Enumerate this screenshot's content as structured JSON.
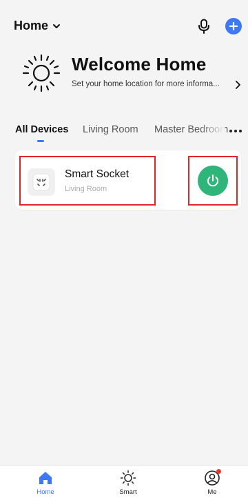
{
  "header": {
    "home_label": "Home"
  },
  "welcome": {
    "title": "Welcome Home",
    "subtitle": "Set your home location for more informa..."
  },
  "tabs": [
    {
      "label": "All Devices",
      "active": true
    },
    {
      "label": "Living Room",
      "active": false
    },
    {
      "label": "Master Bedroom",
      "active": false
    }
  ],
  "device": {
    "name": "Smart Socket",
    "room": "Living Room",
    "power_color": "#2fb57a"
  },
  "bottom_nav": [
    {
      "label": "Home",
      "icon": "home-icon",
      "active": true
    },
    {
      "label": "Smart",
      "icon": "sun-icon",
      "active": false
    },
    {
      "label": "Me",
      "icon": "profile-icon",
      "active": false
    }
  ],
  "colors": {
    "accent": "#3e78f7",
    "highlight": "#e0242b",
    "notification": "#ea3b33"
  }
}
